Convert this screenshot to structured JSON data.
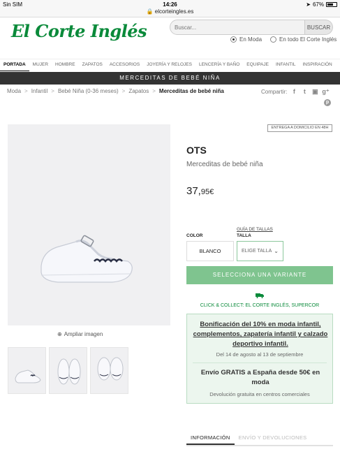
{
  "status_bar": {
    "carrier": "Sin SIM",
    "time": "14:26",
    "battery": "67%",
    "battery_level": 0.67
  },
  "browser": {
    "url": "elcorteingles.es"
  },
  "header": {
    "logo_text": "El Corte Inglés",
    "search": {
      "placeholder": "Buscar...",
      "button_label": "BUSCAR"
    },
    "scope_options": [
      {
        "label": "En Moda",
        "selected": true
      },
      {
        "label": "En todo El Corte Inglés",
        "selected": false
      }
    ]
  },
  "nav": {
    "items": [
      "PORTADA",
      "MUJER",
      "HOMBRE",
      "ZAPATOS",
      "ACCESORIOS",
      "JOYERÍA Y RELOJES",
      "LENCERÍA Y BAÑO",
      "EQUIPAJE",
      "INFANTIL",
      "INSPIRACIÓN"
    ],
    "active": "PORTADA"
  },
  "banner": {
    "title": "MERCEDITAS DE BEBÉ NIÑA"
  },
  "breadcrumb": {
    "items": [
      "Moda",
      "Infantil",
      "Bebé Niña (0-36 meses)",
      "Zapatos"
    ],
    "current": "Merceditas de bebé niña"
  },
  "share": {
    "label": "Compartir:",
    "networks": [
      "facebook-icon",
      "twitter-icon",
      "tuenti-icon",
      "google-plus-icon",
      "pinterest-icon"
    ]
  },
  "gallery": {
    "zoom_label": "Ampliar imagen",
    "thumbnail_count": 3
  },
  "product": {
    "delivery_badge": "ENTREGA A DOMICILIO EN 48H",
    "brand": "OTS",
    "name": "Merceditas de bebé niña",
    "price_int": "37,",
    "price_dec": "95€",
    "color_label": "COLOR",
    "color_value": "BLANCO",
    "size_guide_link": "GUÍA DE TALLAS",
    "size_label": "TALLA",
    "size_placeholder": "ELIGE TALLA",
    "cta_label": "SELECCIONA UNA VARIANTE",
    "click_collect": "CLICK & COLLECT: EL CORTE INGLÉS, SUPERCOR"
  },
  "promo": {
    "title": "Bonificación del 10% en moda infantil, complementos, zapatería infantil y calzado deportivo infantil.",
    "dates": "Del 14 de agosto al 13 de septiembre",
    "shipping": "Envío GRATIS a España desde 50€ en moda",
    "returns": "Devolución gratuita en centros comerciales"
  },
  "tabs": {
    "items": [
      "INFORMACIÓN",
      "ENVÍO Y DEVOLUCIONES"
    ],
    "active": "INFORMACIÓN"
  },
  "colors": {
    "brand_green": "#0a8a3a",
    "cta_green": "#7fc48f",
    "banner_dark": "#333333",
    "promo_bg": "#ecf6ee"
  }
}
